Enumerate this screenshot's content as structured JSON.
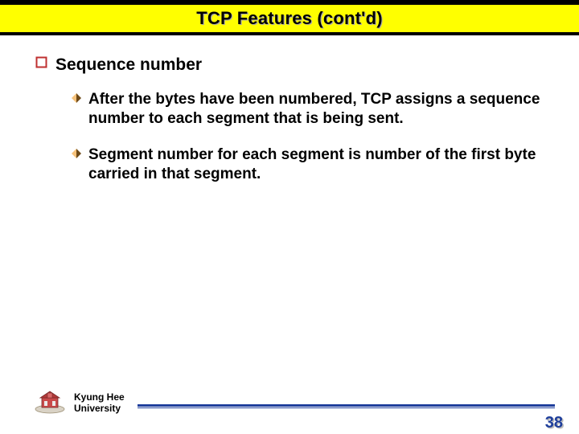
{
  "title": "TCP Features (cont'd)",
  "bullets": {
    "l1": "Sequence number",
    "l2a": "After the bytes have been numbered, TCP assigns a sequence number to each segment that is being sent.",
    "l2b": "Segment number for each segment is number of the first byte carried in that segment."
  },
  "footer": {
    "university": "Kyung Hee\nUniversity"
  },
  "page_number": "38",
  "colors": {
    "title_bg": "#ffff00",
    "bullet_square": "#bf3030",
    "bullet_diamond_light": "#f6c27a",
    "bullet_diamond_dark": "#6e4a18",
    "rule": "#1f3f9c"
  },
  "icons": {
    "square_bullet": "square-bullet-icon",
    "diamond_bullet": "diamond-bullet-icon",
    "university_logo": "university-logo-icon"
  }
}
